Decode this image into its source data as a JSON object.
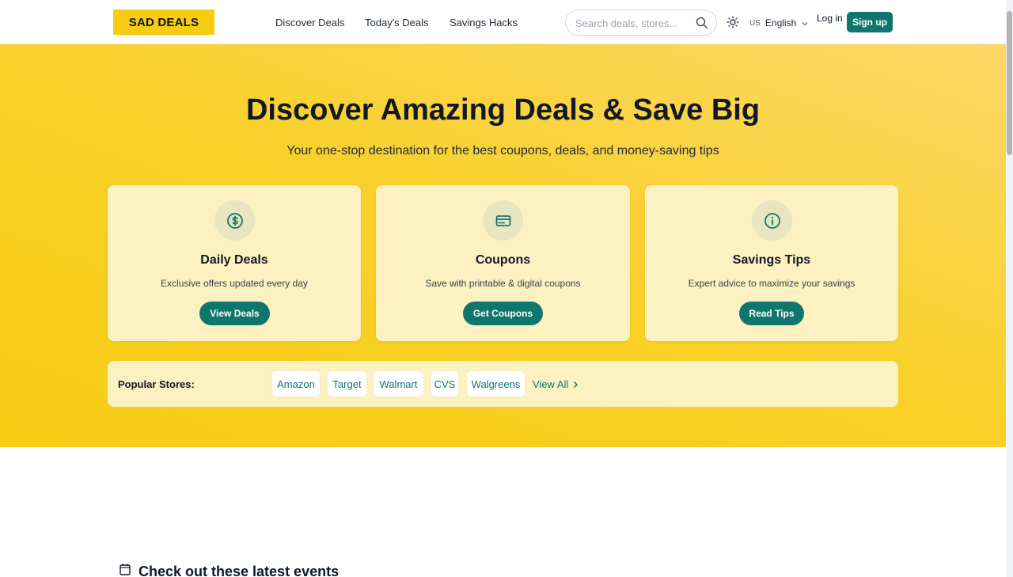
{
  "header": {
    "logo": "SAD DEALS",
    "nav": [
      "Discover Deals",
      "Today's Deals",
      "Savings Hacks"
    ],
    "search_placeholder": "Search deals, stores...",
    "lang_flag": "US",
    "lang_label": "English",
    "login": "Log in",
    "signup": "Sign up"
  },
  "hero": {
    "title": "Discover Amazing Deals & Save Big",
    "subtitle": "Your one-stop destination for the best coupons, deals, and money-saving tips",
    "cards": [
      {
        "icon": "dollar-circle-icon",
        "title": "Daily Deals",
        "desc": "Exclusive offers updated every day",
        "button": "View Deals"
      },
      {
        "icon": "credit-card-icon",
        "title": "Coupons",
        "desc": "Save with printable & digital coupons",
        "button": "Get Coupons"
      },
      {
        "icon": "info-circle-icon",
        "title": "Savings Tips",
        "desc": "Expert advice to maximize your savings",
        "button": "Read Tips"
      }
    ],
    "stores": {
      "label": "Popular Stores:",
      "items": [
        "Amazon",
        "Target",
        "Walmart",
        "CVS",
        "Walgreens"
      ],
      "view_all": "View All"
    }
  },
  "events": {
    "title": "Check out these latest events",
    "icon": "calendar-icon"
  },
  "colors": {
    "brand_yellow": "#f6cd14",
    "accent_teal": "#0f766e",
    "card_bg": "#fdf1c2"
  }
}
